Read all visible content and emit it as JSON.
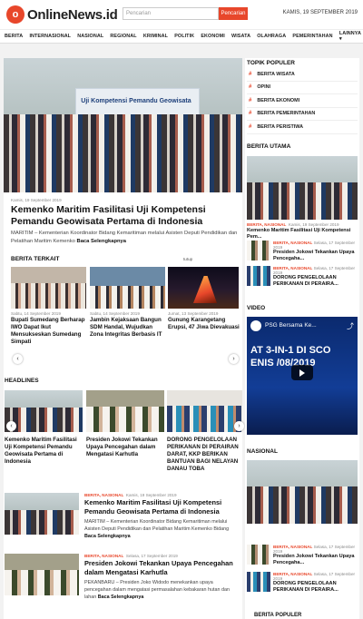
{
  "header": {
    "logo_text": "OnlineNews.id",
    "logo_icon": "o",
    "search_placeholder": "Pencarian",
    "search_button": "Pencarian",
    "date": "KAMIS, 19 SEPTEMBER 2019"
  },
  "nav": {
    "items": [
      "BERITA",
      "INTERNASIONAL",
      "NASIONAL",
      "REGIONAL",
      "KRIMINAL",
      "POLITIK",
      "EKONOMI",
      "WISATA",
      "OLAHRAGA",
      "PEMERINTAHAN",
      "LAINNYA ▾"
    ]
  },
  "hero": {
    "banner": "Uji Kompetensi Pemandu Geowisata",
    "date": "Kamis, 19 September 2019",
    "title": "Kemenko Maritim Fasilitasi Uji Kompetensi Pemandu Geowisata Pertama di Indonesia",
    "excerpt": "MARITIM – Kementerian Koordinator Bidang Kemaritiman melalui Asisten Deputi Pendidikan dan Pelatihan Maritim Kemenko",
    "read_more": "Baca Selengkapnya"
  },
  "terkait": {
    "title": "BERITA TERKAIT",
    "close": "tutup",
    "items": [
      {
        "date": "Sabtu, 14 September 2019",
        "title": "Bupati Sumedang Berharap IWO Dapat Ikut Mensukseskan Sumedang Simpati"
      },
      {
        "date": "Sabtu, 14 September 2019",
        "title": "Jambin Kejaksaan Bangun SDM Handal, Wujudkan Zona Integritas Berbasis IT"
      },
      {
        "date": "Jumat, 13 September 2019",
        "title": "Gunung Karangetang Erupsi, 47 Jiwa Dievakuasi"
      }
    ]
  },
  "headlines": {
    "title": "HEADLINES",
    "items": [
      {
        "title": "Kemenko Maritim Fasilitasi Uji Kompetensi Pemandu Geowisata Pertama di Indonesia"
      },
      {
        "title": "Presiden Jokowi Tekankan Upaya Pencegahan dalam Mengatasi Karhutla"
      },
      {
        "title": "DORONG PENGELOLAAN PERIKANAN DI PERAIRAN DARAT, KKP BERIKAN BANTUAN BAGI NELAYAN DANAU TOBA"
      }
    ]
  },
  "list": [
    {
      "cat": "BERITA, NASIONAL",
      "date": "Kamis, 19 September 2019",
      "title": "Kemenko Maritim Fasilitasi Uji Kompetensi Pemandu Geowisata Pertama di Indonesia",
      "excerpt": "MARITIM – Kementerian Koordinator Bidang Kemaritiman melalui Asisten Deputi Pendidikan dan Pelatihan Maritim Kemenko Bidang",
      "read_more": "Baca Selengkapnya"
    },
    {
      "cat": "BERITA, NASIONAL",
      "date": "Selasa, 17 September 2019",
      "title": "Presiden Jokowi Tekankan Upaya Pencegahan dalam Mengatasi Karhutla",
      "excerpt": "PEKANBARU – Presiden Joko Widodo menekankan upaya pencegahan dalam mengatasi permasalahan kebakaran hutan dan lahan",
      "read_more": "Baca Selengkapnya"
    }
  ],
  "sidebar": {
    "populer_title": "TOPIK POPULER",
    "topics": [
      "BERITA WISATA",
      "OPINI",
      "BERITA EKONOMI",
      "BERITA PEMERINTAHAN",
      "BERITA PERISTIWA"
    ],
    "utama_title": "BERITA UTAMA",
    "utama_main": {
      "cat": "BERITA, NASIONAL",
      "date": "Kamis, 19 September 2019",
      "title": "Kemenko Maritim Fasilitasi Uji Kompetensi Pem..."
    },
    "utama_items": [
      {
        "cat": "BERITA, NASIONAL",
        "date": "Selasa, 17 September 2019",
        "title": "Presiden Jokowi Tekankan Upaya Pencegaha..."
      },
      {
        "cat": "BERITA, NASIONAL",
        "date": "Selasa, 17 September 2019",
        "title": "DORONG PENGELOLAAN PERIKANAN DI PERAIRA..."
      }
    ],
    "video_title": "VIDEO",
    "video_name": "PSG Bersama Ke...",
    "video_overlay": "AT 3-IN-1 DI SCO  ENIS /08/2019",
    "nasional_title": "NASIONAL",
    "nasional_items": [
      {
        "cat": "BERITA, NASIONAL",
        "date": "Selasa, 17 September 2019",
        "title": "Presiden Jokowi Tekankan Upaya Pencegaha..."
      },
      {
        "cat": "BERITA, NASIONAL",
        "date": "Selasa, 17 September 2019",
        "title": "DORONG PENGELOLAAN PERIKANAN DI PERAIRA..."
      }
    ],
    "bottom_title": "BERITA POPULER"
  },
  "colors": {
    "accent": "#e8472b"
  }
}
